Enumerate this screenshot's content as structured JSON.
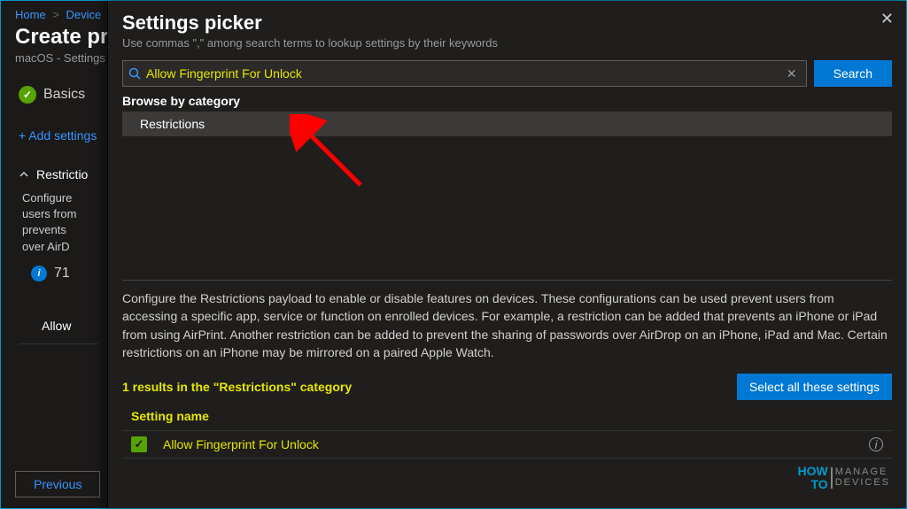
{
  "breadcrumb": {
    "home": "Home",
    "device": "Device"
  },
  "background": {
    "title": "Create pr",
    "subtitle": "macOS - Settings",
    "step_basics": "Basics",
    "add_settings": "+ Add settings",
    "section": "Restrictio",
    "desc_l1": "Configure",
    "desc_l2": "users from",
    "desc_l3": "prevents",
    "desc_l4": "over AirD",
    "badge_num": "71",
    "allow_text": "Allow"
  },
  "prev_btn": "Previous",
  "panel": {
    "title": "Settings picker",
    "subtitle": "Use commas \",\" among search terms to lookup settings by their keywords",
    "search_value": "Allow Fingerprint For Unlock",
    "search_btn": "Search",
    "browse": "Browse by category",
    "category": "Restrictions",
    "description": "Configure the Restrictions payload to enable or disable features on devices. These configurations can be used prevent users from accessing a specific app, service or function on enrolled devices. For example, a restriction can be added that prevents an iPhone or iPad from using AirPrint. Another restriction can be added to prevent the sharing of passwords over AirDrop on an iPhone, iPad and Mac. Certain restrictions on an iPhone may be mirrored on a paired Apple Watch.",
    "results_count": "1 results in the \"Restrictions\" category",
    "select_all": "Select all these settings",
    "col_header": "Setting name",
    "setting_name": "Allow Fingerprint For Unlock"
  },
  "watermark": {
    "how": "HOW",
    "to": "TO",
    "manage": "MANAGE",
    "devices": "DEVICES"
  }
}
